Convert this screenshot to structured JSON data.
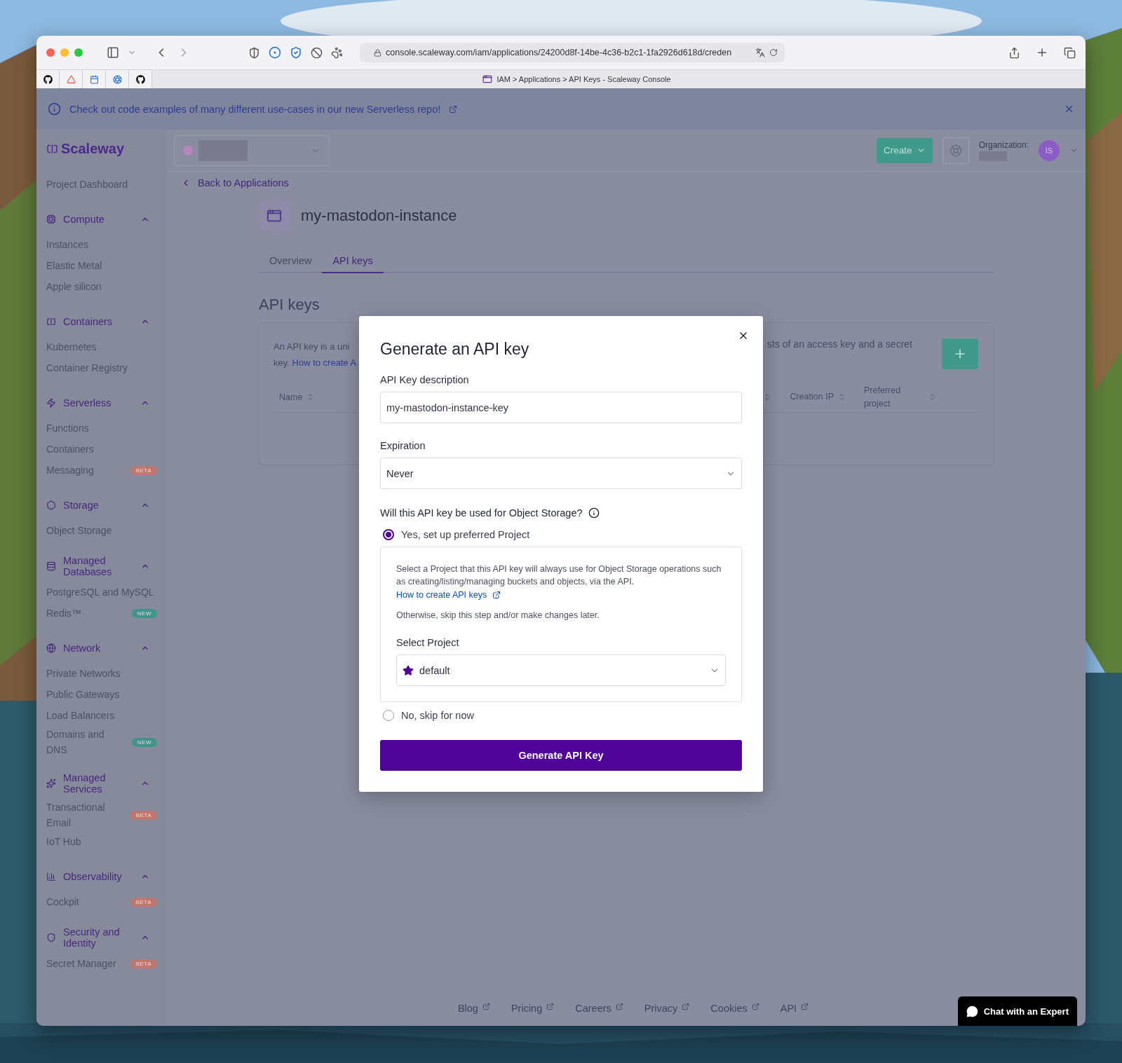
{
  "browser": {
    "url": "console.scaleway.com/iam/applications/24200d8f-14be-4c36-b2c1-1fa2926d618d/creden",
    "tab_title": "IAM > Applications > API Keys - Scaleway Console"
  },
  "banner": {
    "text": "Check out code examples of many different use-cases in our new Serverless repo!"
  },
  "sidebar": {
    "brand": "Scaleway",
    "items": [
      {
        "label": "Project Dashboard"
      }
    ],
    "groups": [
      {
        "title": "Compute",
        "expanded": true,
        "items": [
          {
            "label": "Instances"
          },
          {
            "label": "Elastic Metal"
          },
          {
            "label": "Apple silicon"
          }
        ]
      },
      {
        "title": "Containers",
        "expanded": true,
        "items": [
          {
            "label": "Kubernetes"
          },
          {
            "label": "Container Registry"
          }
        ]
      },
      {
        "title": "Serverless",
        "expanded": true,
        "items": [
          {
            "label": "Functions"
          },
          {
            "label": "Containers"
          },
          {
            "label": "Messaging",
            "badge": {
              "text": "BETA",
              "color": "#c0776f"
            }
          }
        ]
      },
      {
        "title": "Storage",
        "expanded": true,
        "items": [
          {
            "label": "Object Storage"
          }
        ]
      },
      {
        "title": "Managed Databases",
        "expanded": true,
        "items": [
          {
            "label": "PostgreSQL and MySQL"
          },
          {
            "label": "Redis™",
            "badge": {
              "text": "NEW",
              "color": "#3f9688"
            }
          }
        ]
      },
      {
        "title": "Network",
        "expanded": true,
        "items": [
          {
            "label": "Private Networks"
          },
          {
            "label": "Public Gateways"
          },
          {
            "label": "Load Balancers"
          },
          {
            "label": "Domains and DNS",
            "badge": {
              "text": "NEW",
              "color": "#3f9688"
            }
          }
        ]
      },
      {
        "title": "Managed Services",
        "expanded": true,
        "items": [
          {
            "label": "Transactional Email",
            "badge": {
              "text": "BETA",
              "color": "#c0776f"
            }
          },
          {
            "label": "IoT Hub"
          }
        ]
      },
      {
        "title": "Observability",
        "expanded": true,
        "items": [
          {
            "label": "Cockpit",
            "badge": {
              "text": "BETA",
              "color": "#c0776f"
            }
          }
        ]
      },
      {
        "title": "Security and Identity",
        "expanded": true,
        "items": [
          {
            "label": "Secret Manager",
            "badge": {
              "text": "BETA",
              "color": "#c0776f"
            }
          }
        ]
      }
    ]
  },
  "header": {
    "create_button": "Create",
    "organization_label": "Organization:",
    "avatar": "IS"
  },
  "page": {
    "back_link": "Back to Applications",
    "title": "my-mastodon-instance",
    "tabs": [
      {
        "label": "Overview",
        "selected": false
      },
      {
        "label": "API keys",
        "selected": true
      }
    ],
    "section_title": "API keys",
    "card": {
      "text_left": "An API key is a uni",
      "text_left_2": "key.",
      "link": "How to create A",
      "text_right": "sts of an access key and a secret",
      "columns_left": [
        "Name"
      ],
      "columns_right": [
        "Creation IP",
        "Preferred project"
      ]
    }
  },
  "modal": {
    "title": "Generate an API key",
    "description_label": "API Key description",
    "description_value": "my-mastodon-instance-key",
    "expiration_label": "Expiration",
    "expiration_value": "Never",
    "question": "Will this API key be used for Object Storage?",
    "options": [
      {
        "label": "Yes, set up preferred Project",
        "selected": true
      },
      {
        "label": "No, skip for now",
        "selected": false
      }
    ],
    "info": "Select a Project that this API key will always use for Object Storage operations such as creating/listing/managing buckets and objects, via the API.",
    "link": "How to create API keys",
    "note": "Otherwise, skip this step and/or make changes later.",
    "select_label": "Select Project",
    "project": "default",
    "button": "Generate API Key"
  },
  "footer": {
    "links": [
      "Blog",
      "Pricing",
      "Careers",
      "Privacy",
      "Cookies",
      "API"
    ],
    "chat_button": "Chat with an Expert"
  }
}
